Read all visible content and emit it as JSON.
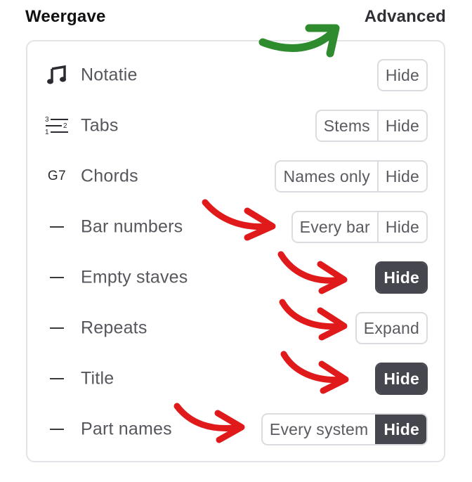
{
  "header": {
    "title": "Weergave",
    "advanced_link": "Advanced"
  },
  "rows": [
    {
      "icon": "music-note-icon",
      "label": "Notatie",
      "options": [
        "Hide"
      ],
      "active": []
    },
    {
      "icon": "tab-staff-icon",
      "label": "Tabs",
      "options": [
        "Stems",
        "Hide"
      ],
      "active": []
    },
    {
      "icon": "chord-icon",
      "icon_text": "G7",
      "label": "Chords",
      "options": [
        "Names only",
        "Hide"
      ],
      "active": []
    },
    {
      "icon": "dash-icon",
      "label": "Bar numbers",
      "options": [
        "Every bar",
        "Hide"
      ],
      "active": []
    },
    {
      "icon": "dash-icon",
      "label": "Empty staves",
      "options": [
        "Hide"
      ],
      "active": [
        "Hide"
      ]
    },
    {
      "icon": "dash-icon",
      "label": "Repeats",
      "options": [
        "Expand"
      ],
      "active": []
    },
    {
      "icon": "dash-icon",
      "label": "Title",
      "options": [
        "Hide"
      ],
      "active": [
        "Hide"
      ]
    },
    {
      "icon": "dash-icon",
      "label": "Part names",
      "options": [
        "Every system",
        "Hide"
      ],
      "active": [
        "Hide"
      ]
    }
  ],
  "tab_icon_numbers": [
    "3",
    "2",
    "1"
  ],
  "colors": {
    "green_arrow": "#2e8b2e",
    "red_arrow": "#e01a1a",
    "active_button": "#45464e"
  }
}
